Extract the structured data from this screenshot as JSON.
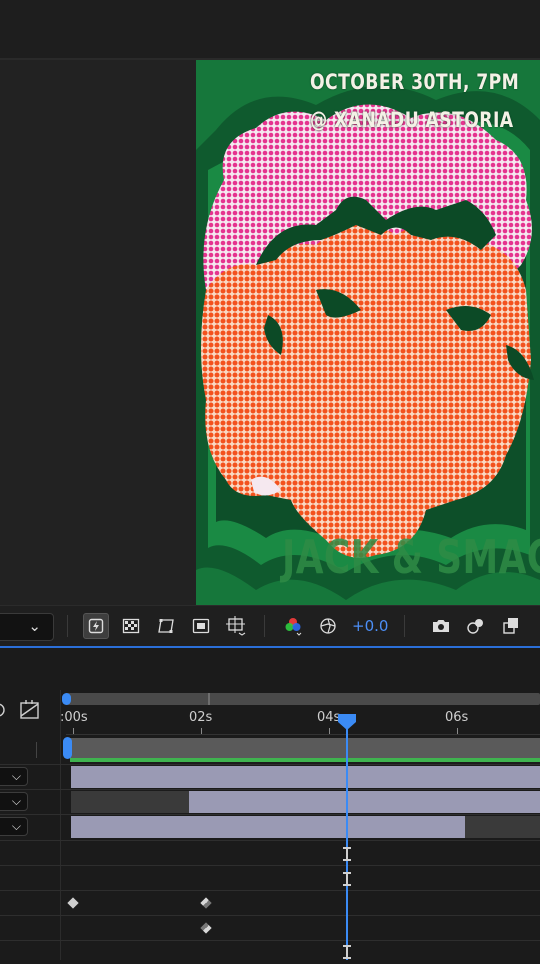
{
  "poster": {
    "line1": "OCTOBER 30TH, 7PM",
    "line2": "@ XANADU ASTORIA",
    "title": "JACK & SMACK"
  },
  "viewer_toolbar": {
    "exposure": "+0.0",
    "icons": [
      "fast-preview-icon",
      "transparency-grid-icon",
      "mask-path-icon",
      "region-of-interest-icon",
      "guides-icon",
      "color-channels-icon",
      "exposure-reset-icon",
      "snapshot-icon",
      "show-snapshot-icon",
      "copy-frame-icon"
    ]
  },
  "timeline": {
    "time_labels": [
      ":00s",
      "02s",
      "04s",
      "06s"
    ]
  },
  "colors": {
    "accent": "#3b8bf5",
    "work_area_green": "#3fb34f",
    "layer_bar": "#9a9ab4",
    "poster_green": "#0e4c2a",
    "poster_pink": "#e5348f",
    "poster_orange": "#f3521e"
  }
}
